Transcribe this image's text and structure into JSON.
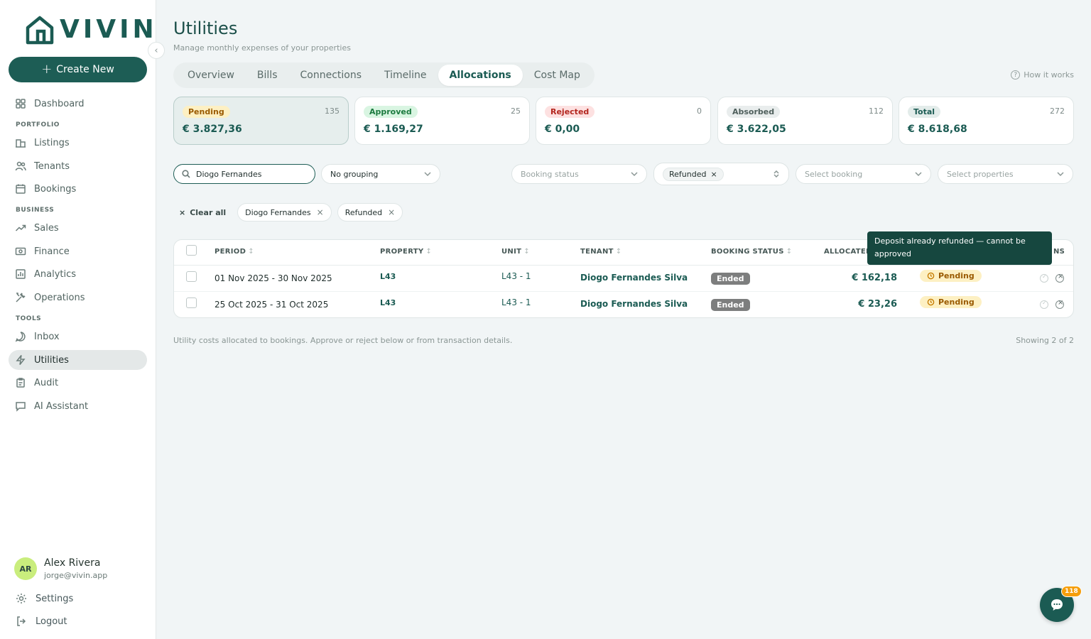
{
  "brand": {
    "name": "VIVIN"
  },
  "sidebar": {
    "create_label": "Create New",
    "items": [
      {
        "label": "Dashboard"
      },
      {
        "label": "Listings"
      },
      {
        "label": "Tenants"
      },
      {
        "label": "Bookings"
      },
      {
        "label": "Sales"
      },
      {
        "label": "Finance"
      },
      {
        "label": "Analytics"
      },
      {
        "label": "Operations"
      },
      {
        "label": "Inbox"
      },
      {
        "label": "Utilities"
      },
      {
        "label": "Audit"
      },
      {
        "label": "AI Assistant"
      }
    ],
    "sections": [
      "PORTFOLIO",
      "BUSINESS",
      "TOOLS"
    ],
    "user": {
      "initials": "AR",
      "name": "Alex Rivera",
      "email": "jorge@vivin.app"
    },
    "settings_label": "Settings",
    "logout_label": "Logout"
  },
  "header": {
    "title": "Utilities",
    "subtitle": "Manage monthly expenses of your properties",
    "how_it_works": "How it works",
    "tabs": [
      "Overview",
      "Bills",
      "Connections",
      "Timeline",
      "Allocations",
      "Cost Map"
    ],
    "active_tab": "Allocations"
  },
  "stats": [
    {
      "label": "Pending",
      "count": "135",
      "amount": "€ 3.827,36",
      "bg": "#fdf0c3",
      "fg": "#9a5a00"
    },
    {
      "label": "Approved",
      "count": "25",
      "amount": "€ 1.169,27",
      "bg": "#d9f5e2",
      "fg": "#1c7a3f"
    },
    {
      "label": "Rejected",
      "count": "0",
      "amount": "€ 0,00",
      "bg": "#fde1e1",
      "fg": "#b3261e"
    },
    {
      "label": "Absorbed",
      "count": "112",
      "amount": "€ 3.622,05",
      "bg": "#e9eded",
      "fg": "#4f5f5c"
    },
    {
      "label": "Total",
      "count": "272",
      "amount": "€ 8.618,68",
      "bg": "#e3ecea",
      "fg": "#1b5b53"
    }
  ],
  "filters": {
    "search_value": "Diogo Fernandes",
    "grouping": "No grouping",
    "booking_status_placeholder": "Booking status",
    "refund_chip": "Refunded",
    "booking_placeholder": "Select booking",
    "properties_placeholder": "Select properties",
    "clear_all": "Clear all",
    "active": [
      "Diogo Fernandes",
      "Refunded"
    ]
  },
  "table": {
    "headers": {
      "period": "PERIOD",
      "property": "PROPERTY",
      "unit": "UNIT",
      "tenant": "TENANT",
      "booking_status": "BOOKING STATUS",
      "allocated": "ALLOCATED",
      "actions_tail": "NS"
    },
    "rows": [
      {
        "period": "01 Nov 2025 - 30 Nov 2025",
        "property": "L43",
        "unit": "L43 - 1",
        "tenant": "Diogo Fernandes Silva",
        "booking_status": "Ended",
        "allocated": "€ 162,18",
        "status": "Pending"
      },
      {
        "period": "25 Oct 2025 - 31 Oct 2025",
        "property": "L43",
        "unit": "L43 - 1",
        "tenant": "Diogo Fernandes Silva",
        "booking_status": "Ended",
        "allocated": "€ 23,26",
        "status": "Pending"
      }
    ],
    "tooltip": "Deposit already refunded — cannot be approved",
    "footer_note": "Utility costs allocated to bookings. Approve or reject below or from transaction details.",
    "footer_count": "Showing 2 of 2"
  },
  "chat": {
    "badge": "118"
  }
}
